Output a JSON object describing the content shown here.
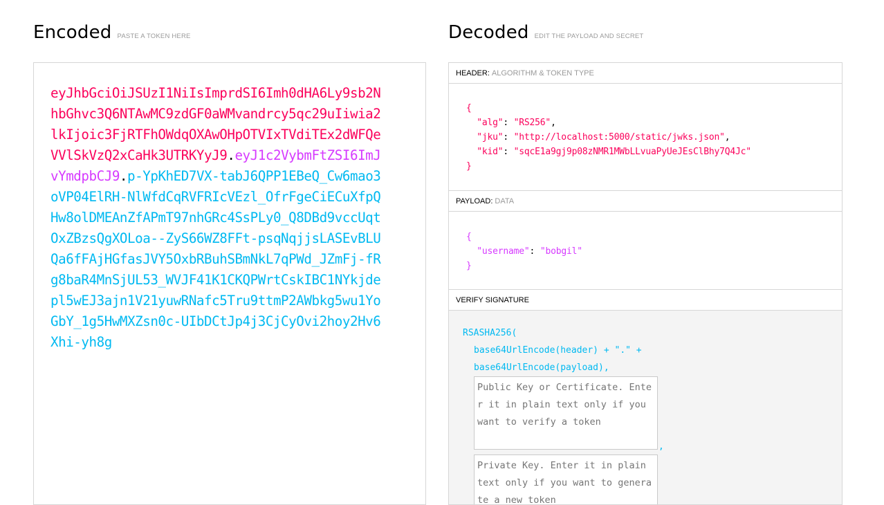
{
  "encoded": {
    "title": "Encoded",
    "subtitle": "PASTE A TOKEN HERE",
    "token_header": "eyJhbGciOiJSUzI1NiIsImprdSI6Imh0dHA6Ly9sb2NhbGhvc3Q6NTAwMC9zdGF0aWMvandrcy5qc29uIiwia2lkIjoic3FjRTFhOWdqOXAwOHpOTVIxTVdiTEx2dWFQeVVlSkVzQ2xCaHk3UTRKYyJ9",
    "token_payload": "eyJ1c2VybmFtZSI6ImJvYmdpbCJ9",
    "token_signature": "p-YpKhED7VX-tabJ6QPP1EBeQ_Cw6mao3oVP04ElRH-NlWfdCqRVFRIcVEzl_OfrFgeCiECuXfpQHw8olDMEAnZfAPmT97nhGRc4SsPLy0_Q8DBd9vccUqtOxZBzsQgXOLoa--ZyS66WZ8FFt-psqNqjjsLASEvBLUQa6fFAjHGfasJVY5OxbRBuhSBmNkL7qPWd_JZmFj-fRg8baR4MnSjUL53_WVJF41K1CKQPWrtCskIBC1NYkjdepl5wEJ3ajn1V21yuwRNafc5Tru9ttmP2AWbkg5wu1YoGbY_1g5HwMXZsn0c-UIbDCtJp4j3CjCyOvi2hoy2Hv6Xhi-yh8g",
    "dot": "."
  },
  "decoded": {
    "title": "Decoded",
    "subtitle": "EDIT THE PAYLOAD AND SECRET",
    "header_section": {
      "label": "HEADER:",
      "sublabel": "ALGORITHM & TOKEN TYPE",
      "open_brace": "{",
      "close_brace": "}",
      "fields": [
        {
          "key": "\"alg\"",
          "value": "\"RS256\"",
          "trail": ","
        },
        {
          "key": "\"jku\"",
          "value": "\"http://localhost:5000/static/jwks.json\"",
          "trail": ","
        },
        {
          "key": "\"kid\"",
          "value": "\"sqcE1a9gj9p08zNMR1MWbLLvuaPyUeJEsClBhy7Q4Jc\"",
          "trail": ""
        }
      ]
    },
    "payload_section": {
      "label": "PAYLOAD:",
      "sublabel": "DATA",
      "open_brace": "{",
      "close_brace": "}",
      "fields": [
        {
          "key": "\"username\"",
          "value": "\"bobgil\"",
          "trail": ""
        }
      ]
    },
    "signature_section": {
      "label": "VERIFY SIGNATURE",
      "fn_open": "RSASHA256(",
      "line1": "base64UrlEncode(header) + \".\" +",
      "line2": "base64UrlEncode(payload),",
      "public_key_placeholder": "Public Key or Certificate. Enter it in plain text only if you want to verify a token",
      "private_key_placeholder": "Private Key. Enter it in plain text only if you want to generate a new token",
      "comma": ","
    }
  },
  "colors": {
    "header": "#fb015b",
    "payload": "#d63aff",
    "signature": "#00b9f1"
  }
}
